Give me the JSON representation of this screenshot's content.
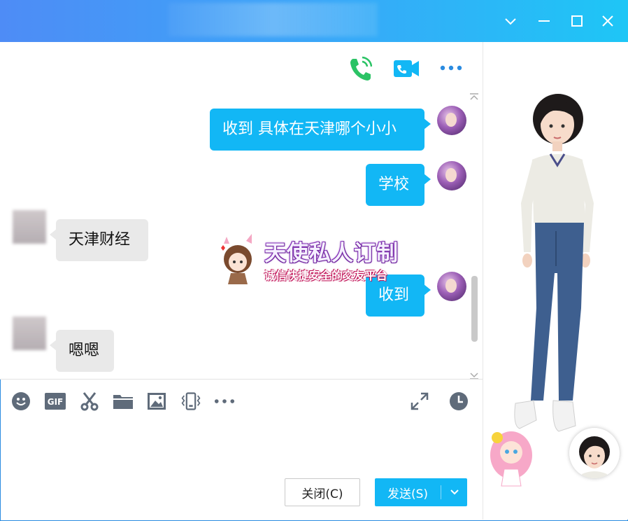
{
  "window": {
    "controls": [
      "chevron-down-icon",
      "minimize-icon",
      "maximize-icon",
      "close-icon"
    ]
  },
  "chat_header": {
    "actions": [
      "phone-call-icon",
      "video-call-icon",
      "more-horizontal-icon"
    ],
    "action_colors": {
      "phone": "#2bc365",
      "video": "#12b7f5",
      "more": "#2a8be0"
    }
  },
  "messages": [
    {
      "side": "out",
      "text": "收到 具体在天津哪个小小"
    },
    {
      "side": "out",
      "text": "学校"
    },
    {
      "side": "in",
      "text": "天津财经"
    },
    {
      "side": "out",
      "text": "收到"
    },
    {
      "side": "in",
      "text": "嗯嗯"
    }
  ],
  "ad": {
    "title": "天使私人订制",
    "subtitle": "诚信快捷安全的交友平台"
  },
  "toolbar": {
    "left_icons": [
      "emoji-icon",
      "gif-icon",
      "screenshot-scissors-icon",
      "folder-icon",
      "image-icon",
      "shake-window-icon",
      "more-horizontal-icon"
    ],
    "right_icons": [
      "expand-icon",
      "history-clock-icon"
    ],
    "gif_label": "GIF"
  },
  "actions": {
    "close_label": "关闭(C)",
    "send_label": "发送(S)"
  },
  "colors": {
    "accent": "#12b7f5",
    "title_gradient_start": "#4e8cf6",
    "title_gradient_end": "#1ec6f6",
    "incoming_bubble": "#e9e9e9",
    "toolbar_icon": "#5f6b7a"
  }
}
